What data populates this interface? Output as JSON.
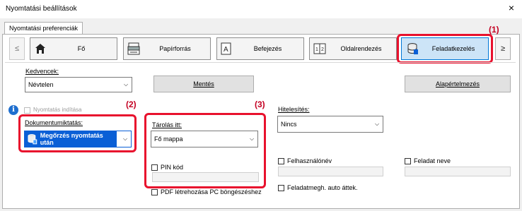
{
  "window": {
    "title": "Nyomtatási beállítások",
    "close_glyph": "×"
  },
  "tab": {
    "label": "Nyomtatási preferenciák"
  },
  "nav": {
    "prev": "≤",
    "next": "≥",
    "items": [
      {
        "label": "Fő",
        "icon": "home-icon"
      },
      {
        "label": "Papírforrás",
        "icon": "paper-tray-icon"
      },
      {
        "label": "Befejezés",
        "icon": "finishing-icon"
      },
      {
        "label": "Oldalrendezés",
        "icon": "layout-icon"
      },
      {
        "label": "Feladatkezelés",
        "icon": "job-handling-icon"
      }
    ]
  },
  "favorites": {
    "label": "Kedvencek:",
    "value": "Névtelen",
    "save": "Mentés",
    "defaults": "Alapértelmezés"
  },
  "info_disabled_label": "Nyomtatás indítása",
  "retention": {
    "label": "Dokumentumiktatás:",
    "value": "Megőrzés nyomtatás után"
  },
  "storage": {
    "label": "Tárolás itt:",
    "value": "Fő mappa",
    "pin_label": "PIN kód",
    "pdf_label": "PDF létrehozása PC böngészéshez"
  },
  "auth": {
    "label": "Hitelesítés:",
    "value": "Nincs",
    "username_label": "Felhasználónév",
    "jobname_label": "Feladat neve",
    "auto_job_label": "Feladatmegh. auto áttek."
  },
  "callouts": {
    "c1": "(1)",
    "c2": "(2)",
    "c3": "(3)"
  },
  "colors": {
    "highlight": "#e8112d",
    "retention_bg": "#0a5fd6",
    "active_nav": "#cce4f7"
  }
}
